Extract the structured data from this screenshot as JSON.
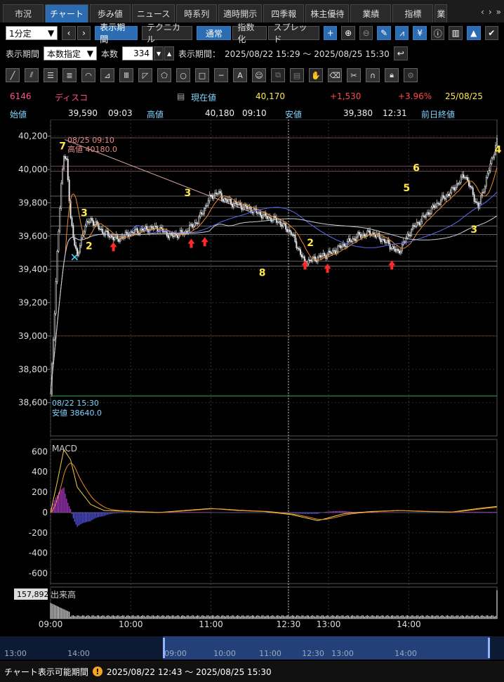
{
  "tabs": {
    "items": [
      "市況",
      "チャート",
      "歩み値",
      "ニュース",
      "時系列",
      "適時開示",
      "四季報",
      "株主優待",
      "業績",
      "指標",
      "業"
    ],
    "active": 1,
    "prev": "‹",
    "next": "›",
    "more": "»"
  },
  "toolbar": {
    "interval": "1分定",
    "display_period": "表示期間",
    "technical": "テクニカル",
    "normal": "通常",
    "index": "指数化",
    "spread": "スプレッド"
  },
  "period_bar": {
    "label": "表示期間",
    "mode": "本数指定",
    "count_label": "本数",
    "count": "334",
    "range_label": "表示期間：",
    "range": "2025/08/22 15:29 ～ 2025/08/25 15:30"
  },
  "quote": {
    "code": "6146",
    "name": "ディスコ",
    "current_label": "現在値",
    "current": "40,170",
    "change": "+1,530",
    "change_pct": "+3.96%",
    "date": "25/08/25",
    "open_label": "始値",
    "open": "39,590",
    "open_time": "09:03",
    "high_label": "高値",
    "high": "40,180",
    "high_time": "09:10",
    "low_label": "安値",
    "low": "39,380",
    "low_time": "12:31",
    "prev_close_label": "前日終値"
  },
  "main_chart": {
    "high_annot_time": "08/25 09:10",
    "high_annot": "高値 40180.0",
    "low_annot_time": "08/22 15:30",
    "low_annot": "安値 38640.0",
    "counts": [
      "7",
      "3",
      "2",
      "3",
      "8",
      "2",
      "6",
      "5",
      "4",
      "3"
    ]
  },
  "macd": {
    "label": "MACD"
  },
  "volume": {
    "label": "出来高",
    "max": "157,892"
  },
  "x_axis": [
    "09:00",
    "10:00",
    "11:00",
    "12:30",
    "13:00",
    "14:00"
  ],
  "navigator_ticks": [
    "13:00",
    "14:00",
    "09:00",
    "10:00",
    "11:00",
    "12:30",
    "13:00",
    "14:00"
  ],
  "footer": {
    "label": "チャート表示可能期間",
    "range": "2025/08/22 12:43 ～ 2025/08/25 15:30"
  },
  "colors": {
    "candle": "#e8e8e8",
    "ma_short": "#f08a2a",
    "ma_mid": "#5a6cf0",
    "ma_long": "#cfcfcf",
    "macd_line": "#f0d040",
    "signal_line": "#f08a2a",
    "histogram": "#b83cd8",
    "counts": "#ffe84d",
    "arrows": "#ff2a2a"
  },
  "chart_data": [
    {
      "type": "line",
      "name": "price",
      "y_ticks": [
        38600,
        38800,
        39000,
        39200,
        39400,
        39600,
        39800,
        40000,
        40200
      ],
      "ylim": [
        38400,
        40300
      ],
      "x_ticks": [
        "09:00",
        "10:00",
        "11:00",
        "12:30",
        "13:00",
        "14:00"
      ],
      "x": [
        0,
        5,
        8,
        10,
        12,
        15,
        20,
        25,
        30,
        40,
        50,
        60,
        70,
        80,
        90,
        100,
        110,
        120,
        125,
        130,
        135,
        140,
        150,
        160,
        170,
        180,
        190,
        200,
        210,
        220,
        230,
        240,
        250,
        260,
        270,
        280,
        290,
        300,
        310,
        320,
        334
      ],
      "values": [
        38640,
        39500,
        39900,
        40100,
        40050,
        39700,
        39470,
        39650,
        39700,
        39620,
        39580,
        39620,
        39640,
        39650,
        39600,
        39620,
        39690,
        39840,
        39860,
        39820,
        39800,
        39790,
        39760,
        39720,
        39690,
        39620,
        39440,
        39470,
        39500,
        39550,
        39600,
        39620,
        39570,
        39500,
        39640,
        39720,
        39800,
        39870,
        39970,
        39770,
        40170
      ]
    },
    {
      "type": "line",
      "name": "MACD",
      "y_ticks": [
        -600,
        -400,
        -200,
        0,
        200,
        400,
        600
      ],
      "ylim": [
        -700,
        720
      ],
      "x": [
        0,
        5,
        10,
        15,
        20,
        30,
        40,
        60,
        80,
        100,
        120,
        140,
        160,
        180,
        200,
        220,
        240,
        260,
        280,
        300,
        320,
        334
      ],
      "values": [
        0,
        300,
        620,
        520,
        250,
        80,
        20,
        10,
        0,
        20,
        40,
        20,
        10,
        -20,
        -80,
        -10,
        10,
        20,
        10,
        5,
        40,
        60
      ]
    },
    {
      "type": "bar",
      "name": "出来高",
      "ylim": [
        0,
        157892
      ]
    }
  ]
}
